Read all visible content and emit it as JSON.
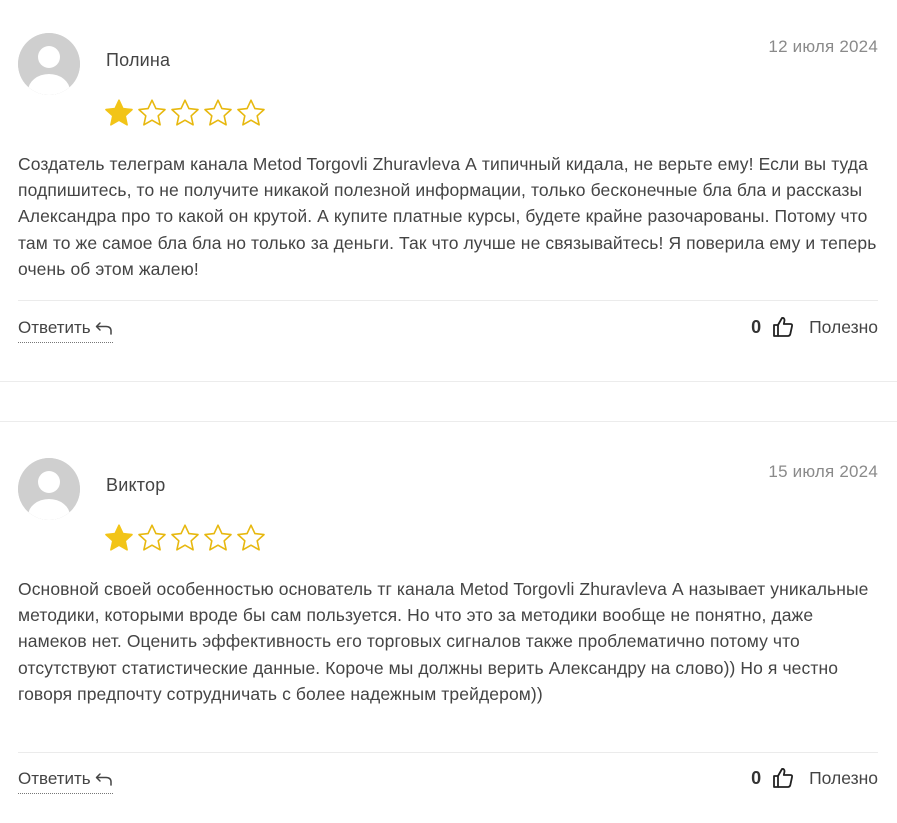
{
  "reviews": [
    {
      "author": "Полина",
      "date": "12 июля 2024",
      "rating": 1,
      "max_rating": 5,
      "text": "Создатель телеграм канала Metod Torgovli Zhuravleva А типичный кидала, не верьте ему! Если вы туда подпишитесь, то не получите никакой полезной информации, только бесконечные бла бла и рассказы Александра про то какой он крутой. А купите платные курсы, будете крайне разочарованы. Потому что там то же самое бла бла но только за деньги. Так что лучше не связывайтесь! Я поверила ему и теперь очень об этом жалею!",
      "reply_label": "Ответить",
      "helpful_count": "0",
      "helpful_label": "Полезно"
    },
    {
      "author": "Виктор",
      "date": "15 июля 2024",
      "rating": 1,
      "max_rating": 5,
      "text": "Основной своей особенностью основатель тг канала Metod Torgovli Zhuravleva А называет уникальные методики, которыми вроде бы сам пользуется. Но что это за методики вообще не понятно, даже намеков нет. Оценить эффективность его торговых сигналов также проблематично потому что отсутствуют статистические данные. Короче мы должны верить Александру на слово)) Но я честно говоря предпочту сотрудничать с более надежным трейдером))",
      "reply_label": "Ответить",
      "helpful_count": "0",
      "helpful_label": "Полезно"
    }
  ],
  "colors": {
    "star_filled": "#f2c417",
    "star_empty_stroke": "#e7b80f",
    "avatar_bg": "#cfcfcf",
    "avatar_fg": "#ffffff"
  },
  "icons": {
    "avatar": "user-placeholder-icon",
    "star": "star-icon",
    "reply": "reply-arrow-icon",
    "helpful": "thumbs-up-icon"
  }
}
